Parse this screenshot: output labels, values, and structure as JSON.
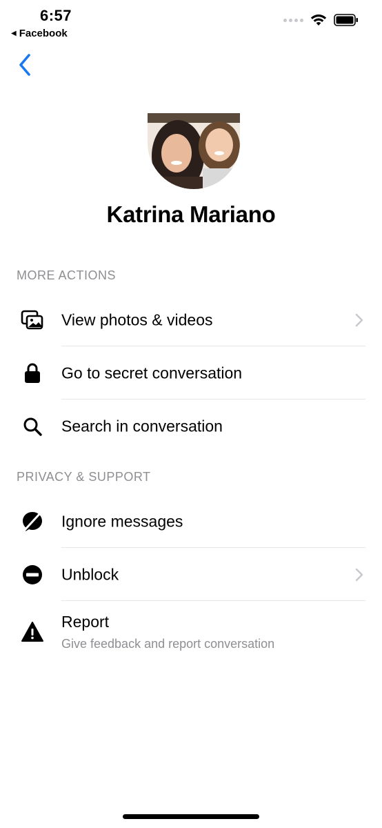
{
  "status_bar": {
    "time": "6:57",
    "back_app": "Facebook",
    "icons": [
      "cellular-signal-icon",
      "wifi-icon",
      "battery-icon"
    ]
  },
  "nav": {
    "back_icon": "chevron-left-icon",
    "accent_color": "#1877F2"
  },
  "profile": {
    "name": "Katrina Mariano"
  },
  "sections": {
    "more_actions": {
      "header": "MORE ACTIONS",
      "items": [
        {
          "label": "View photos & videos",
          "icon": "photos-icon",
          "chevron": true
        },
        {
          "label": "Go to secret conversation",
          "icon": "lock-icon",
          "chevron": false
        },
        {
          "label": "Search in conversation",
          "icon": "search-icon",
          "chevron": false
        }
      ]
    },
    "privacy_support": {
      "header": "PRIVACY & SUPPORT",
      "items": [
        {
          "label": "Ignore messages",
          "icon": "ignore-icon",
          "chevron": false
        },
        {
          "label": "Unblock",
          "icon": "unblock-icon",
          "chevron": true
        },
        {
          "label": "Report",
          "sublabel": "Give feedback and report conversation",
          "icon": "warning-icon",
          "chevron": false
        }
      ]
    }
  }
}
